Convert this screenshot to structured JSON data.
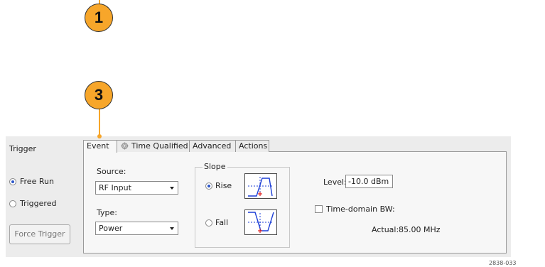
{
  "callouts": [
    "1",
    "3"
  ],
  "trigger_panel": {
    "title": "Trigger",
    "free_run_label": "Free Run",
    "triggered_label": "Triggered",
    "force_trigger_label": "Force Trigger",
    "selected_mode": "Free Run"
  },
  "tabs": [
    {
      "label": "Event",
      "active": true
    },
    {
      "label": "Time Qualified",
      "active": false,
      "icon": "gear-icon"
    },
    {
      "label": "Advanced",
      "active": false
    },
    {
      "label": "Actions",
      "active": false
    }
  ],
  "event": {
    "source_label": "Source:",
    "source_value": "RF Input",
    "type_label": "Type:",
    "type_value": "Power",
    "slope": {
      "title": "Slope",
      "rise_label": "Rise",
      "fall_label": "Fall",
      "selected": "Rise"
    },
    "level_label": "Level:",
    "level_value": "-10.0 dBm",
    "time_domain_bw_label": "Time-domain BW:",
    "time_domain_bw_checked": false,
    "actual_label": "Actual:",
    "actual_value": "85.00 MHz"
  },
  "figure_id": "2838-033",
  "colors": {
    "callout": "#f7a62a",
    "radio_selected": "#2a55c8",
    "trace_blue": "#1d3fd6",
    "marker_red": "#e02020"
  }
}
